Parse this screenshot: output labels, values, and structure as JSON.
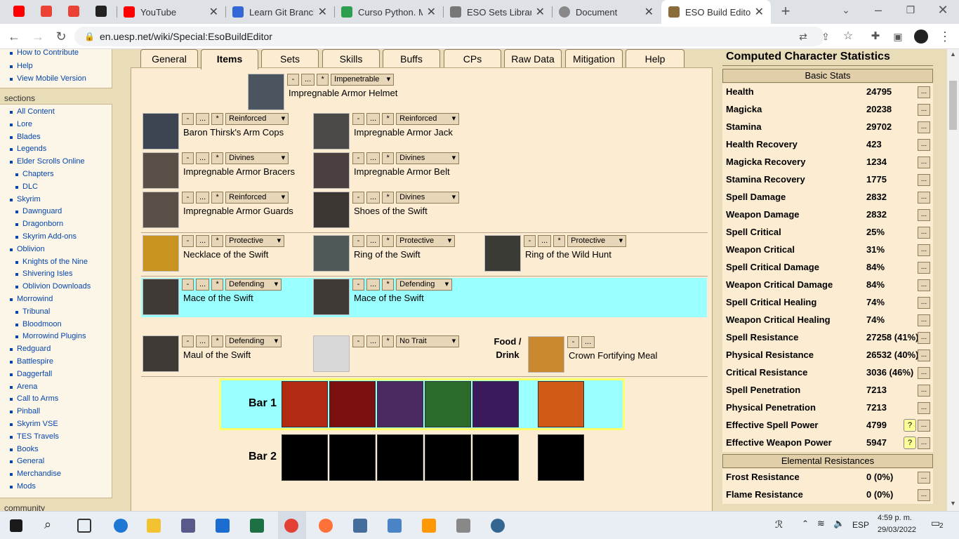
{
  "browser": {
    "tabs": [
      {
        "title": "YouTube",
        "color": "#ff0000"
      },
      {
        "title": "Learn Git Branchi",
        "color": "#3367d6"
      },
      {
        "title": "Curso Python. M",
        "color": "#2e9e4f"
      },
      {
        "title": "ESO Sets Library",
        "color": "#777777"
      },
      {
        "title": "Document",
        "color": "#888888"
      },
      {
        "title": "ESO Build Editor",
        "color": "#8a6d3b"
      }
    ],
    "url": "en.uesp.net/wiki/Special:EsoBuildEditor"
  },
  "sidebar": {
    "top_items": [
      "How to Contribute",
      "Help",
      "View Mobile Version"
    ],
    "sections_heading": "sections",
    "items": [
      {
        "label": "All Content",
        "level": 0
      },
      {
        "label": "Lore",
        "level": 0
      },
      {
        "label": "Blades",
        "level": 0
      },
      {
        "label": "Legends",
        "level": 0
      },
      {
        "label": "Elder Scrolls Online",
        "level": 0
      },
      {
        "label": "Chapters",
        "level": 1
      },
      {
        "label": "DLC",
        "level": 1
      },
      {
        "label": "Skyrim",
        "level": 0
      },
      {
        "label": "Dawnguard",
        "level": 1
      },
      {
        "label": "Dragonborn",
        "level": 1
      },
      {
        "label": "Skyrim Add-ons",
        "level": 1
      },
      {
        "label": "Oblivion",
        "level": 0
      },
      {
        "label": "Knights of the Nine",
        "level": 1
      },
      {
        "label": "Shivering Isles",
        "level": 1
      },
      {
        "label": "Oblivion Downloads",
        "level": 1
      },
      {
        "label": "Morrowind",
        "level": 0
      },
      {
        "label": "Tribunal",
        "level": 1
      },
      {
        "label": "Bloodmoon",
        "level": 1
      },
      {
        "label": "Morrowind Plugins",
        "level": 1
      },
      {
        "label": "Redguard",
        "level": 0
      },
      {
        "label": "Battlespire",
        "level": 0
      },
      {
        "label": "Daggerfall",
        "level": 0
      },
      {
        "label": "Arena",
        "level": 0
      },
      {
        "label": "Call to Arms",
        "level": 0
      },
      {
        "label": "Pinball",
        "level": 0
      },
      {
        "label": "Skyrim VSE",
        "level": 0
      },
      {
        "label": "TES Travels",
        "level": 0
      },
      {
        "label": "Books",
        "level": 0
      },
      {
        "label": "General",
        "level": 0
      },
      {
        "label": "Merchandise",
        "level": 0
      },
      {
        "label": "Mods",
        "level": 0
      }
    ],
    "community_heading": "community"
  },
  "editor": {
    "tabs": [
      "General",
      "Items",
      "Sets",
      "Skills",
      "Buffs",
      "CPs",
      "Raw Data",
      "Mitigation",
      "Help"
    ],
    "active_tab": "Items",
    "btn_minus": "-",
    "btn_more": "...",
    "btn_star": "*",
    "items": [
      {
        "name": "Impregnable Armor Helmet",
        "trait": "Impenetrable",
        "color": "#4a5560"
      },
      {
        "name": "Baron Thirsk's Arm Cops",
        "trait": "Reinforced",
        "color": "#3d4452"
      },
      {
        "name": "Impregnable Armor Jack",
        "trait": "Reinforced",
        "color": "#4c4a48"
      },
      {
        "name": "Impregnable Armor Bracers",
        "trait": "Divines",
        "color": "#5a5048"
      },
      {
        "name": "Impregnable Armor Belt",
        "trait": "Divines",
        "color": "#4a4040"
      },
      {
        "name": "Impregnable Armor Guards",
        "trait": "Reinforced",
        "color": "#5b5048"
      },
      {
        "name": "Shoes of the Swift",
        "trait": "Divines",
        "color": "#3c3632"
      },
      {
        "name": "Necklace of the Swift",
        "trait": "Protective",
        "color": "#c8941f"
      },
      {
        "name": "Ring of the Swift",
        "trait": "Protective",
        "color": "#4f5a58"
      },
      {
        "name": "Ring of the Wild Hunt",
        "trait": "Protective",
        "color": "#3b3b36"
      },
      {
        "name": "Mace of the Swift",
        "trait": "Defending",
        "color": "#3f3a36"
      },
      {
        "name": "Mace of the Swift",
        "trait": "Defending",
        "color": "#3f3a36"
      },
      {
        "name": "Maul of the Swift",
        "trait": "Defending",
        "color": "#3f3a36"
      },
      {
        "name": "",
        "trait": "No Trait",
        "color": "#d8d8d8"
      }
    ],
    "food_label_1": "Food /",
    "food_label_2": "Drink",
    "food_item": "Crown Fortifying Meal",
    "food_color": "#c9882e",
    "bar1_label": "Bar 1",
    "bar2_label": "Bar 2",
    "bar1_skill_colors": [
      "#b32a12",
      "#7a1010",
      "#4a2a60",
      "#2a6a2a",
      "#3a1a5a",
      "#d25a18"
    ]
  },
  "stats": {
    "title": "Computed Character Statistics",
    "basic_heading": "Basic Stats",
    "basic": [
      {
        "label": "Health",
        "value": "24795"
      },
      {
        "label": "Magicka",
        "value": "20238"
      },
      {
        "label": "Stamina",
        "value": "29702"
      },
      {
        "label": "Health Recovery",
        "value": "423"
      },
      {
        "label": "Magicka Recovery",
        "value": "1234"
      },
      {
        "label": "Stamina Recovery",
        "value": "1775"
      },
      {
        "label": "Spell Damage",
        "value": "2832"
      },
      {
        "label": "Weapon Damage",
        "value": "2832"
      },
      {
        "label": "Spell Critical",
        "value": "25%"
      },
      {
        "label": "Weapon Critical",
        "value": "31%"
      },
      {
        "label": "Spell Critical Damage",
        "value": "84%"
      },
      {
        "label": "Weapon Critical Damage",
        "value": "84%"
      },
      {
        "label": "Spell Critical Healing",
        "value": "74%"
      },
      {
        "label": "Weapon Critical Healing",
        "value": "74%"
      },
      {
        "label": "Spell Resistance",
        "value": "27258 (41%)"
      },
      {
        "label": "Physical Resistance",
        "value": "26532 (40%)"
      },
      {
        "label": "Critical Resistance",
        "value": "3036 (46%)"
      },
      {
        "label": "Spell Penetration",
        "value": "7213"
      },
      {
        "label": "Physical Penetration",
        "value": "7213"
      },
      {
        "label": "Effective Spell Power",
        "value": "4799",
        "help": "?"
      },
      {
        "label": "Effective Weapon Power",
        "value": "5947",
        "help": "?"
      }
    ],
    "elemental_heading": "Elemental Resistances",
    "elemental": [
      {
        "label": "Frost Resistance",
        "value": "0 (0%)"
      },
      {
        "label": "Flame Resistance",
        "value": "0 (0%)"
      }
    ]
  },
  "taskbar": {
    "lang": "ESP",
    "time": "4:59 p. m.",
    "date": "29/03/2022",
    "notifications": "2"
  }
}
